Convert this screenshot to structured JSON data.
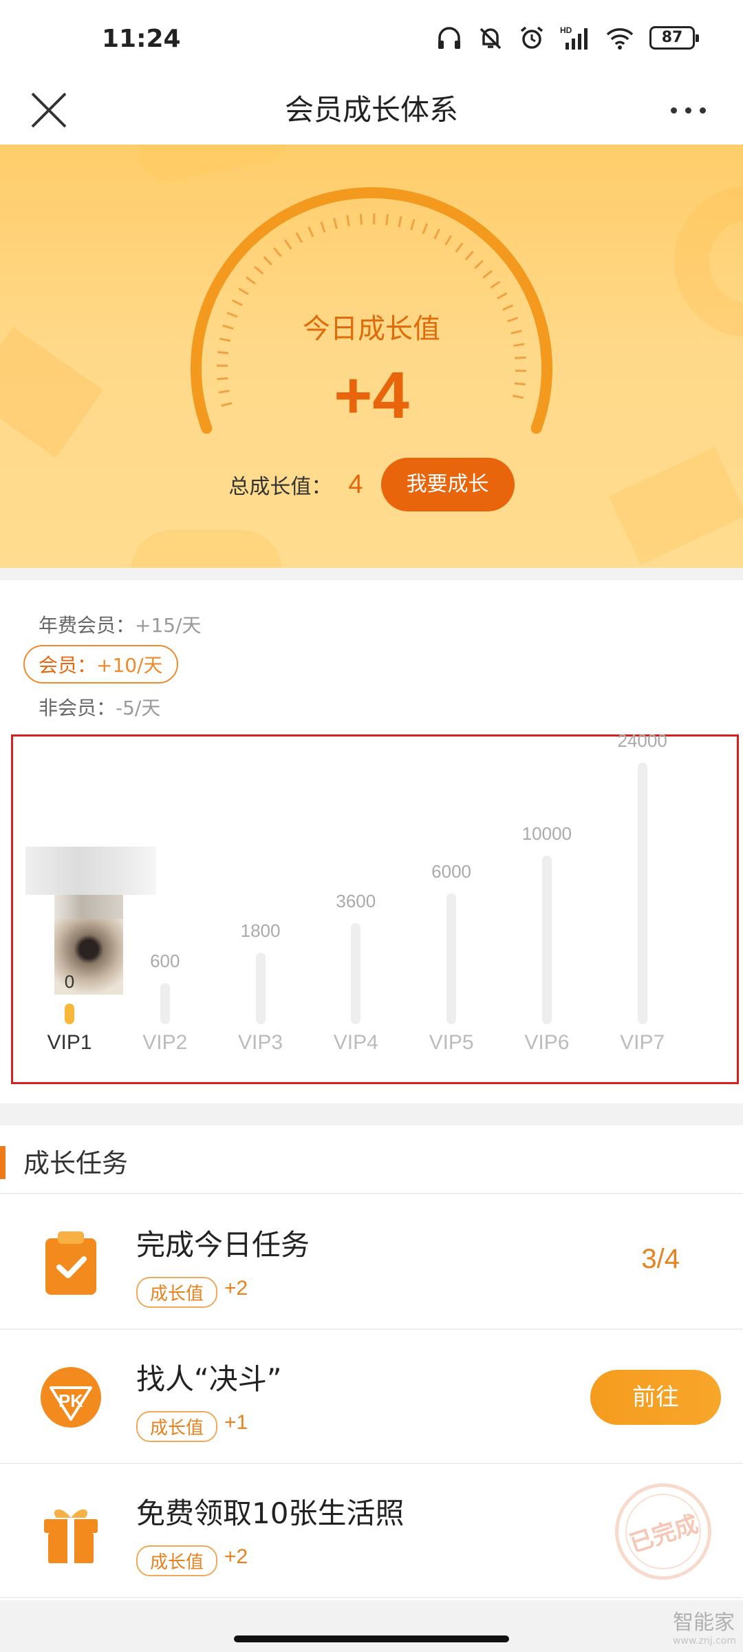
{
  "status_bar": {
    "time": "11:24",
    "battery": "87",
    "icons": [
      "headphones-icon",
      "bell-off-icon",
      "alarm-icon",
      "signal-hd-icon",
      "wifi-icon",
      "battery-icon"
    ]
  },
  "nav": {
    "title": "会员成长体系",
    "close_icon": "close-icon",
    "more_icon": "more-icon"
  },
  "hero": {
    "gauge_label": "今日成长值",
    "gauge_value": "+4",
    "total_label": "总成长值：",
    "total_value": "4",
    "grow_button": "我要成长"
  },
  "rules": [
    {
      "label": "年费会员：",
      "value": "+15/天",
      "active": false
    },
    {
      "label": "会员：",
      "value": "+10/天",
      "active": true
    },
    {
      "label": "非会员：",
      "value": "-5/天",
      "active": false
    }
  ],
  "levels": [
    {
      "name": "VIP1",
      "threshold": "0",
      "current": true
    },
    {
      "name": "VIP2",
      "threshold": "600",
      "current": false
    },
    {
      "name": "VIP3",
      "threshold": "1800",
      "current": false
    },
    {
      "name": "VIP4",
      "threshold": "3600",
      "current": false
    },
    {
      "name": "VIP5",
      "threshold": "6000",
      "current": false
    },
    {
      "name": "VIP6",
      "threshold": "10000",
      "current": false
    },
    {
      "name": "VIP7",
      "threshold": "24000",
      "current": false
    }
  ],
  "tasks": {
    "title": "成长任务",
    "items": [
      {
        "title": "完成今日任务",
        "tag": "成长值",
        "plus": "+2",
        "progress": "3/4",
        "icon": "clipboard-check-icon"
      },
      {
        "title": "找人“决斗”",
        "tag": "成长值",
        "plus": "+1",
        "button": "前往",
        "icon": "pk-badge-icon"
      },
      {
        "title": "免费领取10张生活照",
        "tag": "成长值",
        "plus": "+2",
        "stamp": "已完成",
        "icon": "gift-icon"
      }
    ]
  },
  "watermark": {
    "text": "智能家",
    "sub": "www.znj.com"
  },
  "colors": {
    "accent": "#e8650b",
    "hero_bg": "#ffd479",
    "highlight_box": "#d91e1e",
    "button_orange": "#f59c1e"
  }
}
